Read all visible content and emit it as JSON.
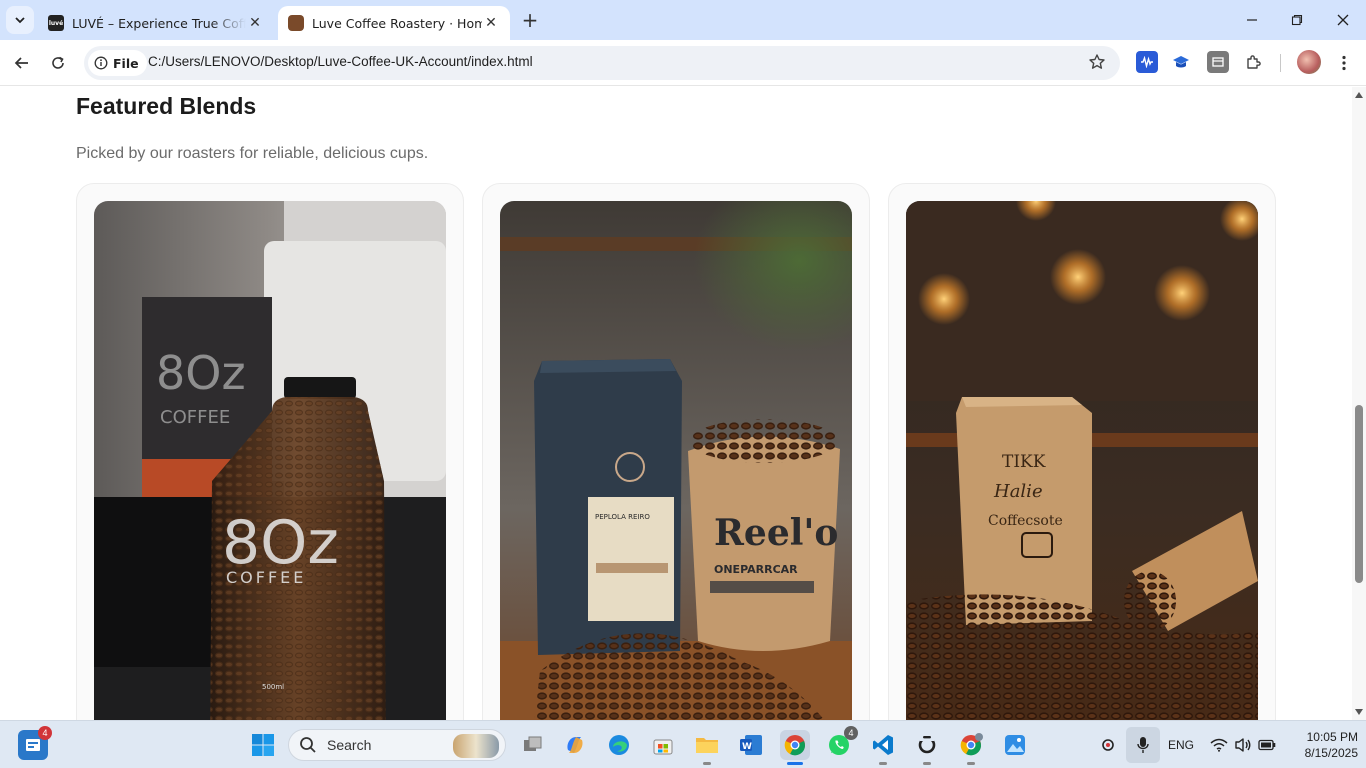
{
  "browser": {
    "tabs": [
      {
        "title": "LUVÉ – Experience True Coffee Excellence",
        "active": false,
        "favicon": "luve-logo-icon"
      },
      {
        "title": "Luve Coffee Roastery · Home",
        "active": true,
        "favicon": "coffee-favicon-icon"
      }
    ],
    "chip_label": "File",
    "url": "C:/Users/LENOVO/Desktop/Luve-Coffee-UK-Account/index.html"
  },
  "page": {
    "heading": "Featured Blends",
    "subheading": "Picked by our roasters for reliable, delicious cups.",
    "cards": [
      {
        "image": "80z-coffee-bottle-photo",
        "text_in_image": [
          "8Oz",
          "COFFEE",
          "500ml"
        ]
      },
      {
        "image": "coffee-bag-and-sack-photo",
        "text_in_image": [
          "PEPLOLA REIRO",
          "Reel'o",
          "ONEPARRCAR"
        ]
      },
      {
        "image": "kraft-coffee-bag-photo",
        "text_in_image": [
          "TIKK",
          "Halie",
          "Coffecsote"
        ]
      }
    ]
  },
  "taskbar": {
    "widgets_badge": "4",
    "search_placeholder": "Search",
    "whatsapp_badge": "4",
    "language": "ENG",
    "time": "10:05 PM",
    "date": "8/15/2025"
  },
  "colors": {
    "tabstrip": "#d3e3fd",
    "taskbar": "#dfe8f3",
    "heading": "#1c1c1c",
    "subtext": "#6b6b6b"
  }
}
